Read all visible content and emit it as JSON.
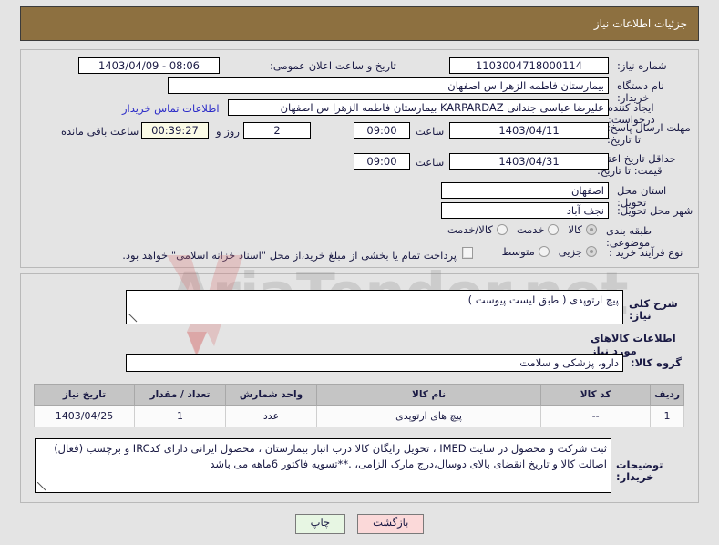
{
  "window": {
    "title": "جزئیات اطلاعات نیاز",
    "header_bg": "#8d7040"
  },
  "watermark": {
    "text": "AriaTender.net"
  },
  "top_form": {
    "labels": {
      "need_number": "شماره نیاز:",
      "announce_datetime": "تاریخ و ساعت اعلان عمومی:",
      "buyer_org": "نام دستگاه خریدار:",
      "creator": "ایجاد کننده درخواست:",
      "reply_deadline": "مهلت ارسال پاسخ: تا تاریخ:",
      "price_validity": "حداقل تاریخ اعتبار قیمت: تا تاریخ:",
      "province": "استان محل تحویل:",
      "city": "شهر محل تحویل:",
      "subject_category": "طبقه بندی موضوعی:",
      "purchase_process": "نوع فرآیند خرید :",
      "hour_1": "ساعت",
      "hour_2": "ساعت",
      "days_and": "روز و",
      "time_remaining": "ساعت باقی مانده"
    },
    "values": {
      "need_number": "1103004718000114",
      "announce_datetime": "08:06 - 1403/04/09",
      "buyer_org": "بیمارستان فاطمه الزهرا س  اصفهان",
      "creator": "علیرضا عباسی جندانی KARPARDAZ بیمارستان فاطمه الزهرا س  اصفهان",
      "reply_deadline_date": "1403/04/11",
      "reply_deadline_time": "09:00",
      "price_validity_date": "1403/04/31",
      "price_validity_time": "09:00",
      "province": "اصفهان",
      "city": "نجف آباد",
      "days_left": "2",
      "countdown": "00:39:27"
    },
    "contact_link": "اطلاعات تماس خریدار",
    "subject_options": [
      {
        "label": "کالا",
        "selected": true
      },
      {
        "label": "خدمت",
        "selected": false
      },
      {
        "label": "کالا/خدمت",
        "selected": false
      }
    ],
    "process_options": [
      {
        "label": "جزیی",
        "selected": true
      },
      {
        "label": "متوسط",
        "selected": false
      }
    ],
    "treasury_checkbox": {
      "checked": false,
      "text": "پرداخت تمام یا بخشی از مبلغ خرید،از محل \"اسناد خزانه اسلامی\" خواهد بود."
    }
  },
  "bottom_form": {
    "need_description_label": "شرح کلی نیاز:",
    "need_description_value": "پیچ ارتوپدی ( طبق لیست پیوست )",
    "goods_section_title": "اطلاعات کالاهای مورد نیاز",
    "goods_group_label": "گروه کالا:",
    "goods_group_value": "دارو، پزشکی و سلامت",
    "table": {
      "headers": [
        "ردیف",
        "کد کالا",
        "نام کالا",
        "واحد شمارش",
        "تعداد / مقدار",
        "تاریخ نیاز"
      ],
      "rows": [
        {
          "radif": "1",
          "code": "--",
          "name": "پیچ های ارتوپدی",
          "unit": "عدد",
          "qty": "1",
          "date": "1403/04/25"
        }
      ]
    },
    "buyer_notes_label": "توضیحات خریدار:",
    "buyer_notes_value": "ثبت شرکت و محصول در سایت IMED ، تحویل رایگان کالا درب انبار بیمارستان ، محصول ایرانی دارای کدIRC و برچسب (فعال) اصالت کالا و تاریخ انقضای بالای دوسال،درج مارک الزامی،  .**تسویه فاکتور 6ماهه می باشد"
  },
  "buttons": {
    "print": "چاپ",
    "back": "بازگشت"
  }
}
